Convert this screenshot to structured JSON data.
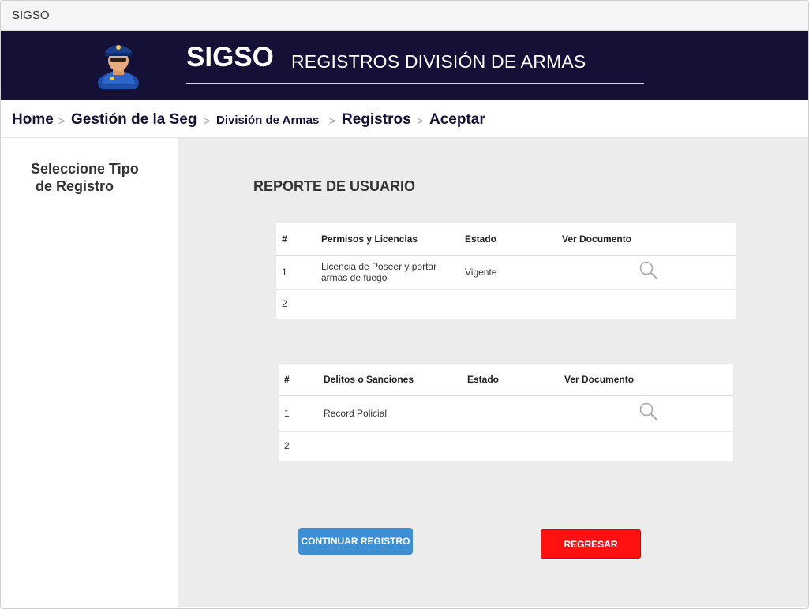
{
  "window": {
    "title": "SIGSO"
  },
  "header": {
    "brand": "SIGSO",
    "subtitle": "REGISTROS DIVISIÓN DE ARMAS",
    "avatar_icon": "police-officer-icon"
  },
  "breadcrumb": {
    "items": [
      {
        "label": "Home"
      },
      {
        "label": "Gestión de la Seg"
      },
      {
        "label": "División de Armas"
      },
      {
        "label": "Registros"
      },
      {
        "label": "Aceptar"
      }
    ],
    "separator": ">"
  },
  "sidebar": {
    "title_line1": "Seleccione Tipo",
    "title_line2": "de Registro"
  },
  "main": {
    "report_title": "REPORTE DE USUARIO",
    "permits_table": {
      "headers": [
        "#",
        "Permisos y Licencias",
        "Estado",
        "Ver Documento"
      ],
      "rows": [
        {
          "num": "1",
          "name": "Licencia de Poseer y portar armas de fuego",
          "status": "Vigente",
          "doc_icon": "magnifier-icon"
        },
        {
          "num": "2",
          "name": "",
          "status": ""
        }
      ]
    },
    "offenses_table": {
      "headers": [
        "#",
        "Delitos o Sanciones",
        "Estado",
        "Ver Documento"
      ],
      "rows": [
        {
          "num": "1",
          "name": "Record Policial",
          "status": "",
          "doc_icon": "magnifier-icon"
        },
        {
          "num": "2",
          "name": "",
          "status": ""
        }
      ]
    },
    "buttons": {
      "continue_label": "CONTINUAR REGISTRO",
      "back_label": "REGRESAR"
    }
  },
  "colors": {
    "header_bg": "#151035",
    "continue_button": "#3d8fd6",
    "back_button": "#ff1111",
    "main_bg": "#ececec"
  }
}
